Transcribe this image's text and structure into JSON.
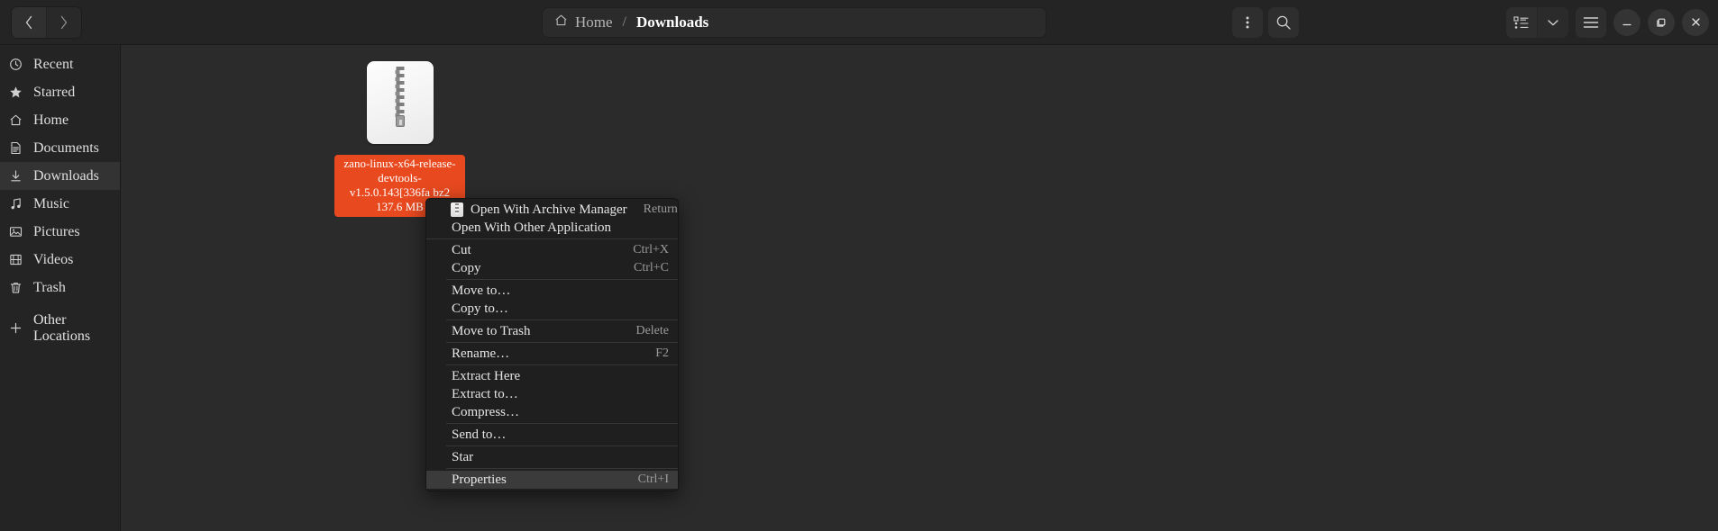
{
  "header": {
    "back_label": "‹",
    "forward_label": "›",
    "breadcrumb": {
      "home_label": "Home",
      "separator": "/",
      "current_label": "Downloads"
    },
    "menu_button_label": "⋮",
    "search_label": "search-icon",
    "view_list_label": "list-view-icon",
    "view_dropdown_label": "⌄",
    "hamburger_label": "☰",
    "minimize_label": "–",
    "maximize_label": "❐",
    "close_label": "✕"
  },
  "sidebar": {
    "items": [
      {
        "label": "Recent",
        "icon": "clock-icon",
        "active": false
      },
      {
        "label": "Starred",
        "icon": "star-icon",
        "active": false
      },
      {
        "label": "Home",
        "icon": "home-icon",
        "active": false
      },
      {
        "label": "Documents",
        "icon": "document-icon",
        "active": false
      },
      {
        "label": "Downloads",
        "icon": "download-icon",
        "active": true
      },
      {
        "label": "Music",
        "icon": "music-note-icon",
        "active": false
      },
      {
        "label": "Pictures",
        "icon": "image-icon",
        "active": false
      },
      {
        "label": "Videos",
        "icon": "film-icon",
        "active": false
      },
      {
        "label": "Trash",
        "icon": "trash-icon",
        "active": false
      }
    ],
    "other_locations": {
      "label": "Other Locations",
      "icon": "plus-icon"
    }
  },
  "file": {
    "name_line1": "zano-linux-x64-release-",
    "name_line2": "devtools-",
    "name_line3": "v1.5.0.143[336fa",
    "name_line4": "bz2",
    "size": "137.6 MB",
    "selected": true,
    "icon": "archive-zip-icon"
  },
  "context_menu": {
    "items": [
      {
        "label": "Open With Archive Manager",
        "accel": "Return",
        "icon": "archive-icon",
        "selected": false,
        "separator_after": false
      },
      {
        "label": "Open With Other Application",
        "accel": "",
        "icon": "",
        "selected": false,
        "separator_after": true
      },
      {
        "label": "Cut",
        "accel": "Ctrl+X",
        "icon": "",
        "selected": false,
        "separator_after": false
      },
      {
        "label": "Copy",
        "accel": "Ctrl+C",
        "icon": "",
        "selected": false,
        "separator_after": true
      },
      {
        "label": "Move to…",
        "accel": "",
        "icon": "",
        "selected": false,
        "separator_after": false
      },
      {
        "label": "Copy to…",
        "accel": "",
        "icon": "",
        "selected": false,
        "separator_after": true
      },
      {
        "label": "Move to Trash",
        "accel": "Delete",
        "icon": "",
        "selected": false,
        "separator_after": true
      },
      {
        "label": "Rename…",
        "accel": "F2",
        "icon": "",
        "selected": false,
        "separator_after": true
      },
      {
        "label": "Extract Here",
        "accel": "",
        "icon": "",
        "selected": false,
        "separator_after": false
      },
      {
        "label": "Extract to…",
        "accel": "",
        "icon": "",
        "selected": false,
        "separator_after": false
      },
      {
        "label": "Compress…",
        "accel": "",
        "icon": "",
        "selected": false,
        "separator_after": true
      },
      {
        "label": "Send to…",
        "accel": "",
        "icon": "",
        "selected": false,
        "separator_after": true
      },
      {
        "label": "Star",
        "accel": "",
        "icon": "",
        "selected": false,
        "separator_after": true
      },
      {
        "label": "Properties",
        "accel": "Ctrl+I",
        "icon": "",
        "selected": true,
        "separator_after": false
      }
    ]
  },
  "colors": {
    "selection": "#e8491f",
    "window_bg": "#242424",
    "content_bg": "#2b2b2b",
    "menu_bg": "#1f1f1f"
  }
}
